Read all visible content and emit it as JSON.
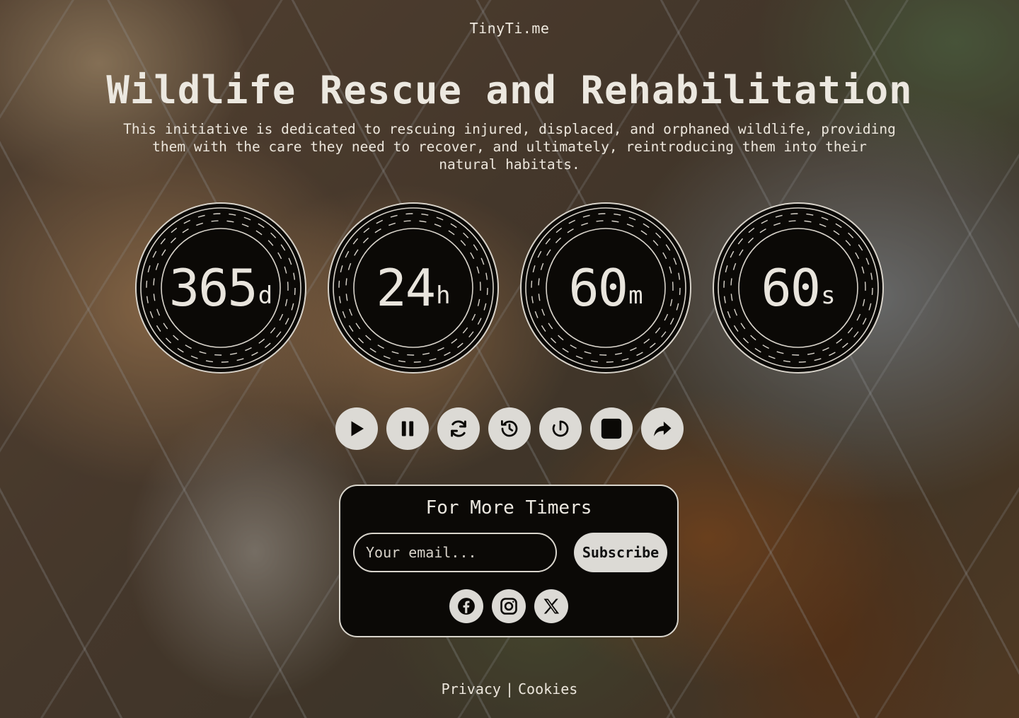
{
  "brand": "TinyTi.me",
  "hero": {
    "title": "Wildlife Rescue and Rehabilitation",
    "subtitle": "This initiative is dedicated to rescuing injured, displaced, and orphaned wildlife, providing them with the care they need to recover, and ultimately, reintroducing them into their natural habitats."
  },
  "timers": [
    {
      "value": "365",
      "unit": "d"
    },
    {
      "value": "24",
      "unit": "h"
    },
    {
      "value": "60",
      "unit": "m"
    },
    {
      "value": "60",
      "unit": "s"
    }
  ],
  "controls": [
    {
      "name": "play-button",
      "icon": "play-icon"
    },
    {
      "name": "pause-button",
      "icon": "pause-icon"
    },
    {
      "name": "reset-button",
      "icon": "refresh-icon"
    },
    {
      "name": "history-button",
      "icon": "history-icon"
    },
    {
      "name": "timer-button",
      "icon": "timer-icon"
    },
    {
      "name": "stop-button",
      "icon": "stop-icon"
    },
    {
      "name": "share-button",
      "icon": "share-icon"
    }
  ],
  "subscribe": {
    "title": "For More Timers",
    "email_placeholder": "Your email...",
    "button_label": "Subscribe"
  },
  "socials": [
    {
      "name": "facebook",
      "icon": "facebook-icon"
    },
    {
      "name": "instagram",
      "icon": "instagram-icon"
    },
    {
      "name": "x",
      "icon": "x-icon"
    }
  ],
  "footer": {
    "privacy": "Privacy",
    "separator": "|",
    "cookies": "Cookies"
  },
  "colors": {
    "dial_bg": "#0b0906",
    "button_bg": "#dcdad5",
    "text": "#ece8e0"
  }
}
